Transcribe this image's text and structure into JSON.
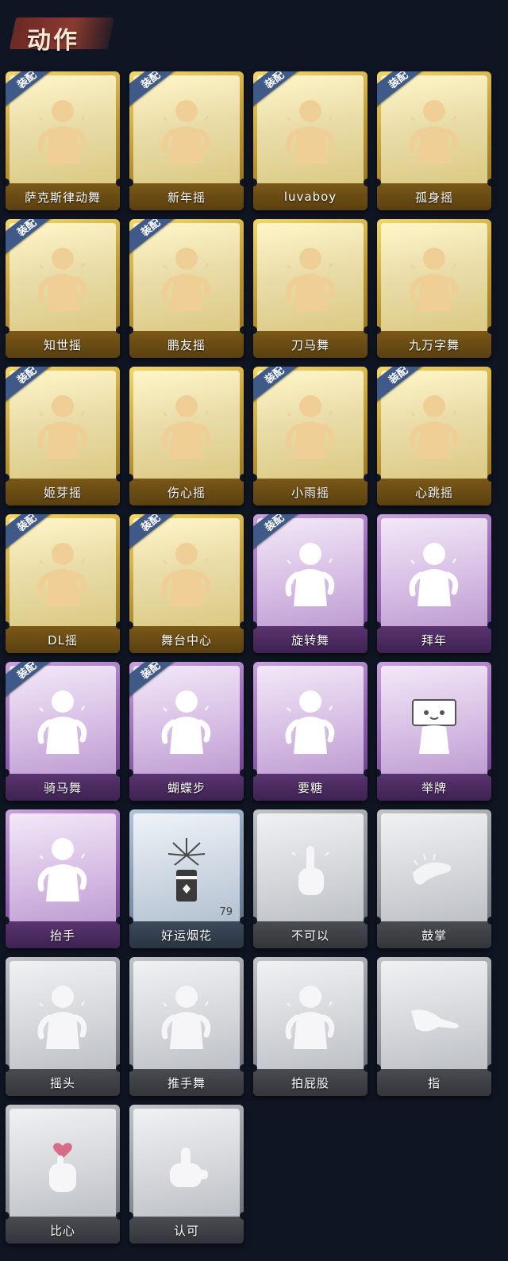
{
  "header": {
    "title": "动作"
  },
  "badge": "装配",
  "colors": {
    "gold": "#d4b04a",
    "purple": "#a77cc4",
    "blue": "#8ea4bc",
    "gray": "#a3a6ab",
    "figure_gold": "#f0cf96",
    "figure_purple": "#ffffff",
    "figure_gray": "#f6f6f8"
  },
  "cards": [
    {
      "label": "萨克斯律动舞",
      "rarity": "gold",
      "equipped": true,
      "icon": "dancer-glasses-icon"
    },
    {
      "label": "新年摇",
      "rarity": "gold",
      "equipped": true,
      "icon": "dancer-icon"
    },
    {
      "label": "luvaboy",
      "rarity": "gold",
      "equipped": true,
      "icon": "dancer-icon"
    },
    {
      "label": "孤身摇",
      "rarity": "gold",
      "equipped": true,
      "icon": "dancer-icon"
    },
    {
      "label": "知世摇",
      "rarity": "gold",
      "equipped": true,
      "icon": "dancer-icon"
    },
    {
      "label": "鹏友摇",
      "rarity": "gold",
      "equipped": true,
      "icon": "dancer-icon"
    },
    {
      "label": "刀马舞",
      "rarity": "gold",
      "equipped": false,
      "icon": "dancer-icon"
    },
    {
      "label": "九万字舞",
      "rarity": "gold",
      "equipped": false,
      "icon": "dancer-icon"
    },
    {
      "label": "姬芽摇",
      "rarity": "gold",
      "equipped": true,
      "icon": "dancer-icon"
    },
    {
      "label": "伤心摇",
      "rarity": "gold",
      "equipped": false,
      "icon": "heart-hands-icon"
    },
    {
      "label": "小雨摇",
      "rarity": "gold",
      "equipped": true,
      "icon": "dancer-icon"
    },
    {
      "label": "心跳摇",
      "rarity": "gold",
      "equipped": true,
      "icon": "dancer-icon"
    },
    {
      "label": "DL摇",
      "rarity": "gold",
      "equipped": true,
      "icon": "dancer-icon"
    },
    {
      "label": "舞台中心",
      "rarity": "gold",
      "equipped": true,
      "icon": "dancer-icon"
    },
    {
      "label": "旋转舞",
      "rarity": "purple",
      "equipped": true,
      "icon": "spin-dancer-icon"
    },
    {
      "label": "拜年",
      "rarity": "purple",
      "equipped": false,
      "icon": "bow-figure-icon"
    },
    {
      "label": "骑马舞",
      "rarity": "purple",
      "equipped": true,
      "icon": "dancer-icon"
    },
    {
      "label": "蝴蝶步",
      "rarity": "purple",
      "equipped": true,
      "icon": "dancer-icon"
    },
    {
      "label": "要糖",
      "rarity": "purple",
      "equipped": false,
      "icon": "figure-icon"
    },
    {
      "label": "举牌",
      "rarity": "purple",
      "equipped": false,
      "icon": "sign-figure-icon"
    },
    {
      "label": "抬手",
      "rarity": "purple",
      "equipped": false,
      "icon": "figure-icon"
    },
    {
      "label": "好运烟花",
      "rarity": "blue",
      "equipped": false,
      "icon": "firework-icon",
      "count": "79"
    },
    {
      "label": "不可以",
      "rarity": "gray",
      "equipped": false,
      "icon": "finger-icon"
    },
    {
      "label": "鼓掌",
      "rarity": "gray",
      "equipped": false,
      "icon": "clap-icon"
    },
    {
      "label": "摇头",
      "rarity": "gray",
      "equipped": false,
      "icon": "figure-icon"
    },
    {
      "label": "推手舞",
      "rarity": "gray",
      "equipped": false,
      "icon": "figure-icon"
    },
    {
      "label": "拍屁股",
      "rarity": "gray",
      "equipped": false,
      "icon": "figure-icon"
    },
    {
      "label": "指",
      "rarity": "gray",
      "equipped": false,
      "icon": "point-icon"
    },
    {
      "label": "比心",
      "rarity": "gray",
      "equipped": false,
      "icon": "finger-heart-icon"
    },
    {
      "label": "认可",
      "rarity": "gray",
      "equipped": false,
      "icon": "thumbs-up-icon"
    }
  ]
}
